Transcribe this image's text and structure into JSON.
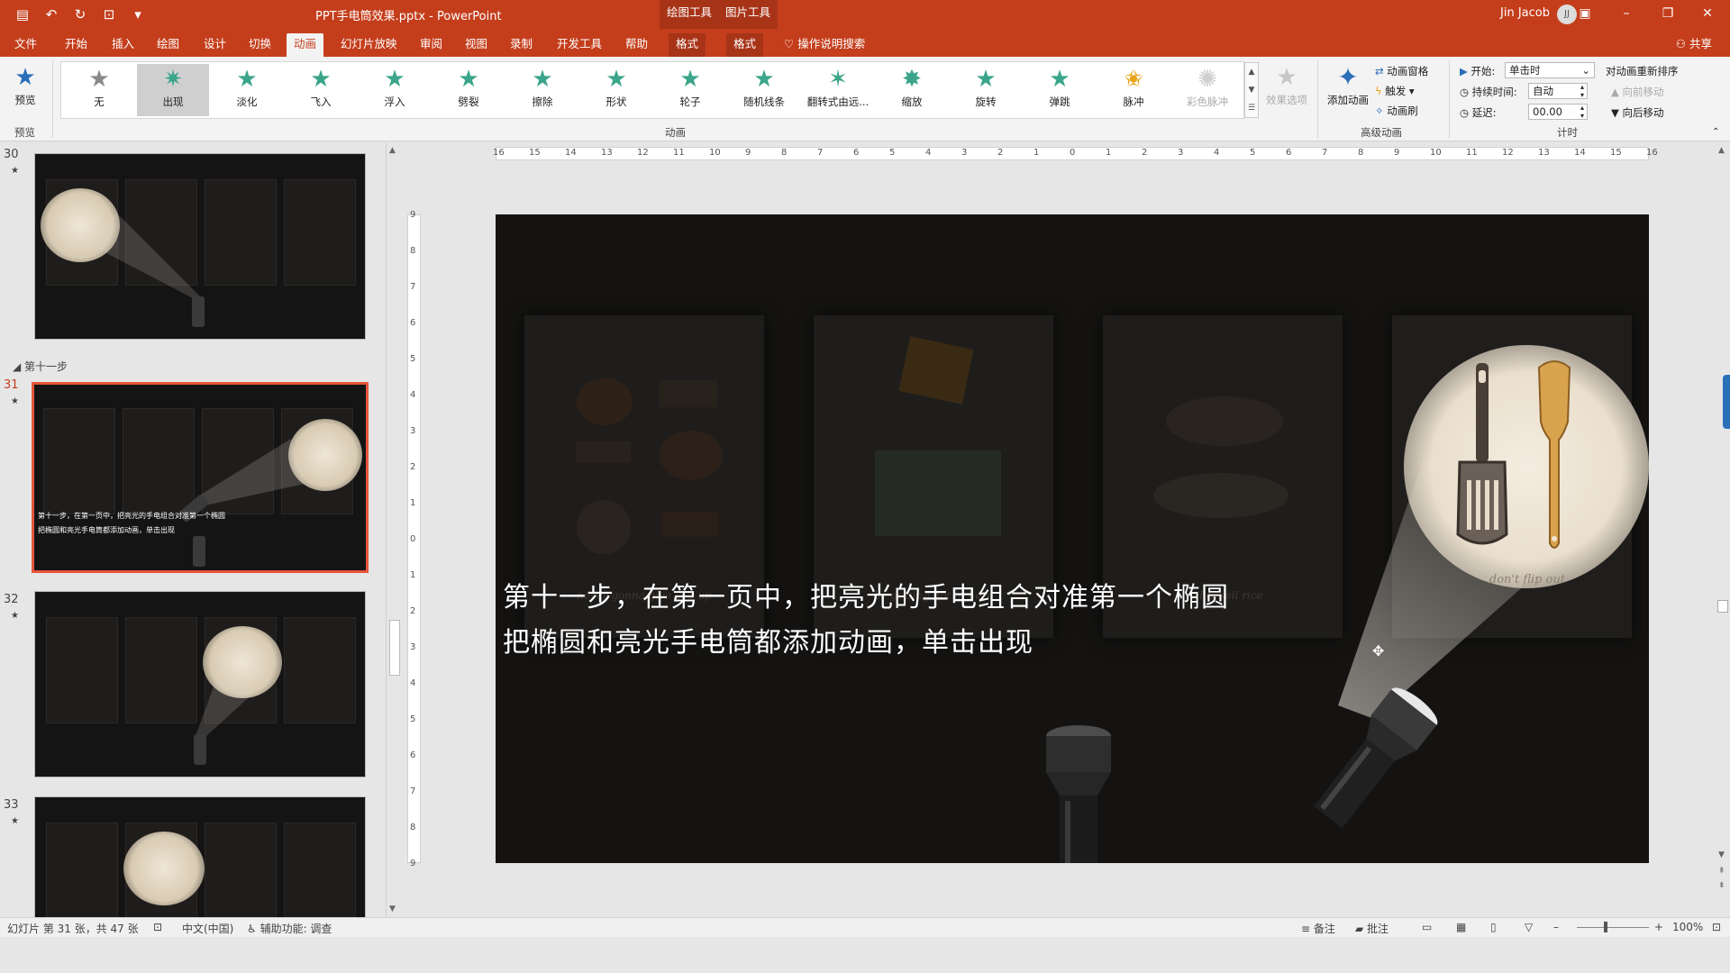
{
  "titlebar": {
    "document_title": "PPT手电筒效果.pptx - PowerPoint",
    "context_groups": [
      "绘图工具",
      "图片工具"
    ],
    "user": "Jin Jacob",
    "avatar_initials": "JJ",
    "accent_color": "#c43e1c"
  },
  "tabs": [
    {
      "label": "文件"
    },
    {
      "label": "开始"
    },
    {
      "label": "插入"
    },
    {
      "label": "绘图"
    },
    {
      "label": "设计"
    },
    {
      "label": "切换"
    },
    {
      "label": "动画"
    },
    {
      "label": "幻灯片放映"
    },
    {
      "label": "审阅"
    },
    {
      "label": "视图"
    },
    {
      "label": "录制"
    },
    {
      "label": "开发工具"
    },
    {
      "label": "帮助"
    },
    {
      "label": "格式"
    },
    {
      "label": "格式"
    }
  ],
  "active_tab": "动画",
  "tell_me": "操作说明搜索",
  "share": "共享",
  "ribbon": {
    "preview": {
      "label": "预览",
      "group": "预览"
    },
    "animations": [
      {
        "label": "无"
      },
      {
        "label": "出现"
      },
      {
        "label": "淡化"
      },
      {
        "label": "飞入"
      },
      {
        "label": "浮入"
      },
      {
        "label": "劈裂"
      },
      {
        "label": "擦除"
      },
      {
        "label": "形状"
      },
      {
        "label": "轮子"
      },
      {
        "label": "随机线条"
      },
      {
        "label": "翻转式由远..."
      },
      {
        "label": "缩放"
      },
      {
        "label": "旋转"
      },
      {
        "label": "弹跳"
      },
      {
        "label": "脉冲"
      },
      {
        "label": "彩色脉冲"
      }
    ],
    "selected_animation": "出现",
    "effect_options": "效果选项",
    "animation_group": "动画",
    "advanced": {
      "add_animation": "添加动画",
      "animation_pane": "动画窗格",
      "trigger": "触发",
      "animation_painter": "动画刷",
      "group": "高级动画"
    },
    "timing": {
      "start_label": "开始:",
      "start_value": "单击时",
      "duration_label": "持续时间:",
      "duration_value": "自动",
      "delay_label": "延迟:",
      "delay_value": "00.00",
      "reorder": "对动画重新排序",
      "move_earlier": "向前移动",
      "move_later": "向后移动",
      "group": "计时"
    }
  },
  "thumbnails": {
    "slides": [
      {
        "number": "30"
      },
      {
        "number": "31",
        "caption_1": "第十一步，在第一页中，把亮光的手电组合对准第一个椭圆",
        "caption_2": "把椭圆和亮光手电筒都添加动画，单击出现"
      },
      {
        "number": "32"
      },
      {
        "number": "33"
      }
    ],
    "section": "第十一步",
    "selected": "31"
  },
  "slide": {
    "mottos": [
      "never gonna give you up",
      "be getting hot in here",
      "boil & sell rice",
      "don't flip out"
    ],
    "caption_line_1": "第十一步，在第一页中，把亮光的手电组合对准第一个椭圆",
    "caption_line_2": "把椭圆和亮光手电筒都添加动画，单击出现"
  },
  "ruler": {
    "horizontal": [
      "16",
      "15",
      "14",
      "13",
      "12",
      "11",
      "10",
      "9",
      "8",
      "7",
      "6",
      "5",
      "4",
      "3",
      "2",
      "1",
      "0",
      "1",
      "2",
      "3",
      "4",
      "5",
      "6",
      "7",
      "8",
      "9",
      "10",
      "11",
      "12",
      "13",
      "14",
      "15",
      "16"
    ],
    "vertical": [
      "9",
      "8",
      "7",
      "6",
      "5",
      "4",
      "3",
      "2",
      "1",
      "0",
      "1",
      "2",
      "3",
      "4",
      "5",
      "6",
      "7",
      "8",
      "9"
    ]
  },
  "statusbar": {
    "slide_info": "幻灯片 第 31 张，共 47 张",
    "language": "中文(中国)",
    "accessibility": "辅助功能: 调查",
    "notes": "备注",
    "comments": "批注",
    "zoom": "100%"
  }
}
